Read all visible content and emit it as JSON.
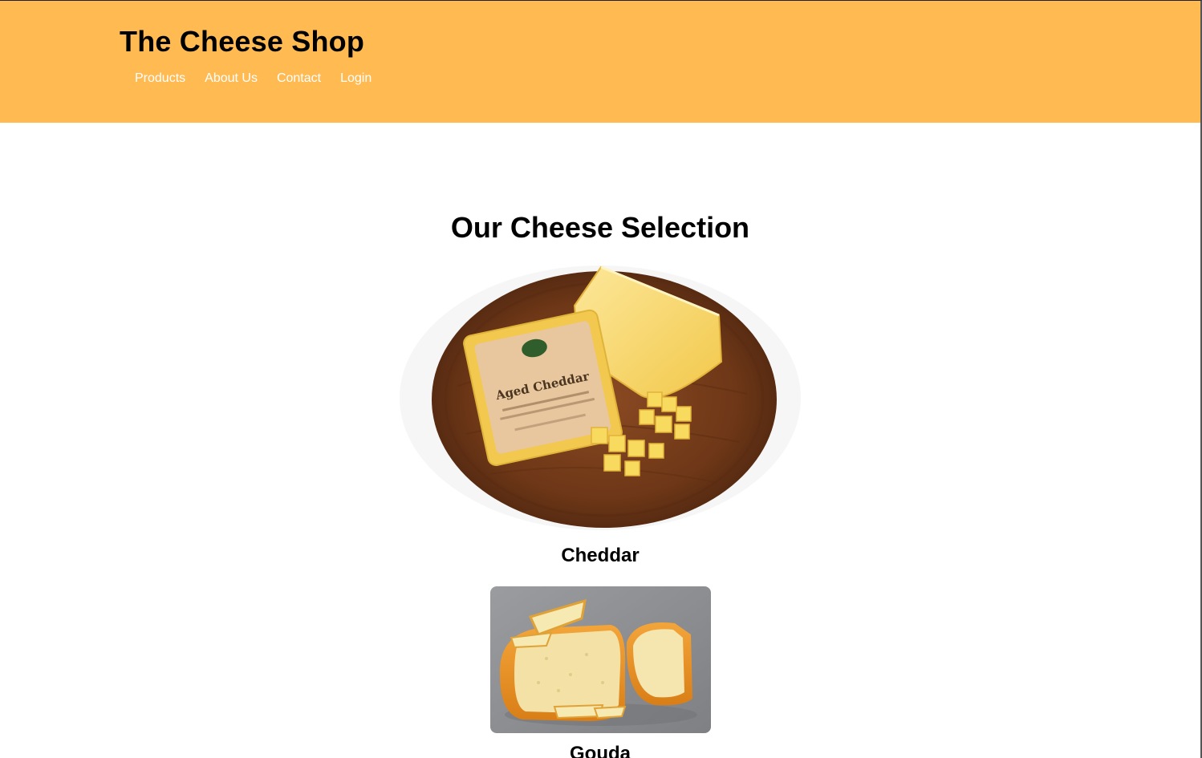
{
  "header": {
    "title": "The Cheese Shop",
    "nav": [
      {
        "label": "Products"
      },
      {
        "label": "About Us"
      },
      {
        "label": "Contact"
      },
      {
        "label": "Login"
      }
    ]
  },
  "main": {
    "title": "Our Cheese Selection",
    "products": [
      {
        "name": "Cheddar",
        "image_icon": "cheddar-photo",
        "package_label": "Aged Cheddar"
      },
      {
        "name": "Gouda",
        "image_icon": "gouda-photo"
      }
    ]
  },
  "colors": {
    "header_bg": "#FFBA52",
    "nav_text": "#FFFFFF",
    "heading_text": "#000000",
    "page_bg": "#FFFFFF"
  }
}
